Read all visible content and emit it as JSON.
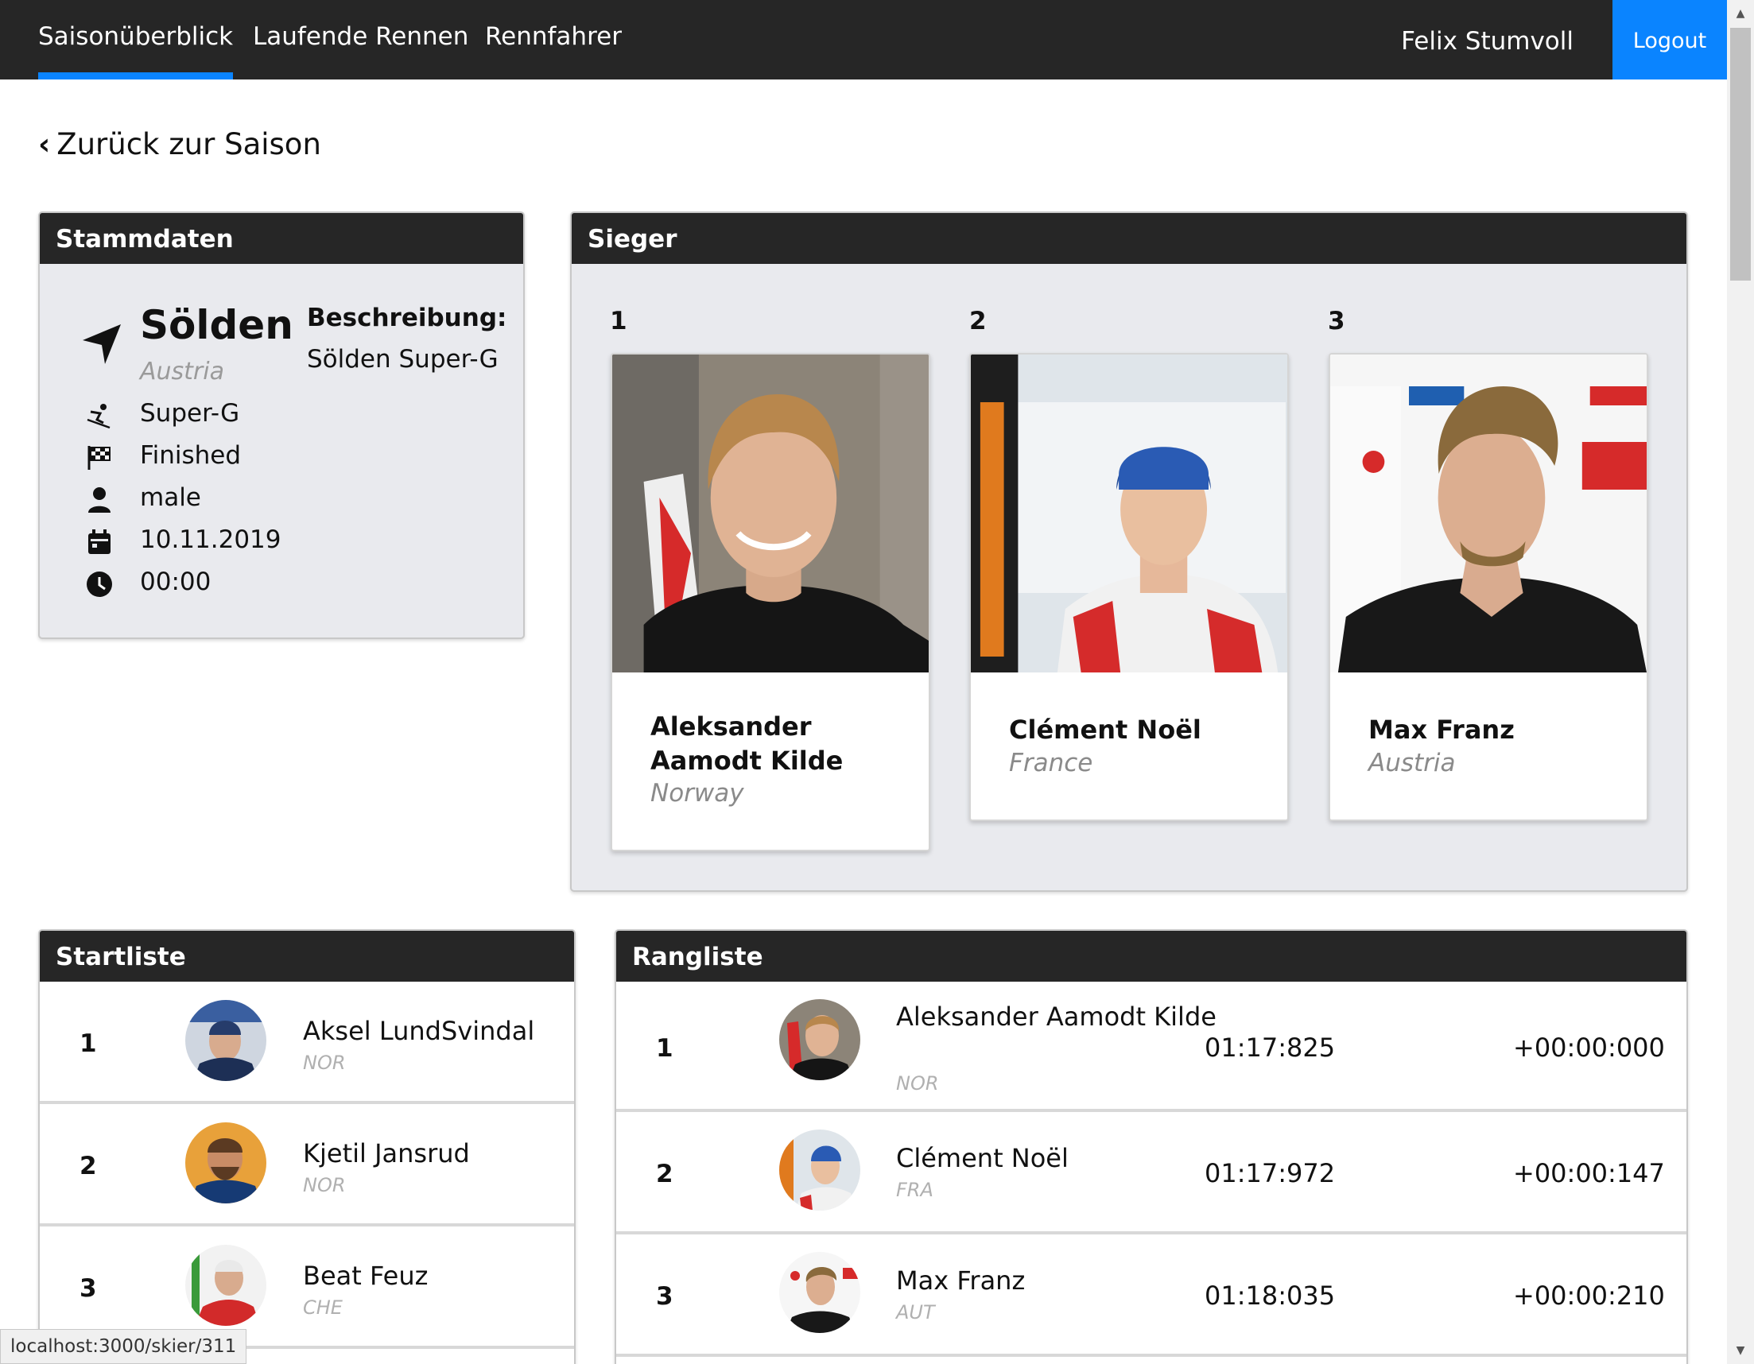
{
  "nav": {
    "items": [
      "Saisonüberblick",
      "Laufende Rennen",
      "Rennfahrer"
    ],
    "user": "Felix Stumvoll",
    "logout": "Logout"
  },
  "back_link": "Zurück zur Saison",
  "stammdaten": {
    "title": "Stammdaten",
    "location": "Sölden",
    "country": "Austria",
    "discipline": "Super-G",
    "status": "Finished",
    "gender": "male",
    "date": "10.11.2019",
    "time": "00:00",
    "description_label": "Beschreibung:",
    "description": "Sölden Super-G"
  },
  "sieger": {
    "title": "Sieger",
    "winners": [
      {
        "rank": "1",
        "name": "Aleksander Aamodt Kilde",
        "country": "Norway"
      },
      {
        "rank": "2",
        "name": "Clément Noël",
        "country": "France"
      },
      {
        "rank": "3",
        "name": "Max Franz",
        "country": "Austria"
      }
    ]
  },
  "startliste": {
    "title": "Startliste",
    "rows": [
      {
        "pos": "1",
        "name": "Aksel LundSvindal",
        "nation": "NOR"
      },
      {
        "pos": "2",
        "name": "Kjetil Jansrud",
        "nation": "NOR"
      },
      {
        "pos": "3",
        "name": "Beat Feuz",
        "nation": "CHE"
      }
    ]
  },
  "rangliste": {
    "title": "Rangliste",
    "rows": [
      {
        "pos": "1",
        "name": "Aleksander Aamodt Kilde",
        "nation": "NOR",
        "time": "01:17:825",
        "diff": "+00:00:000"
      },
      {
        "pos": "2",
        "name": "Clément Noël",
        "nation": "FRA",
        "time": "01:17:972",
        "diff": "+00:00:147"
      },
      {
        "pos": "3",
        "name": "Max Franz",
        "nation": "AUT",
        "time": "01:18:035",
        "diff": "+00:00:210"
      }
    ]
  },
  "status_url": "localhost:3000/skier/311"
}
